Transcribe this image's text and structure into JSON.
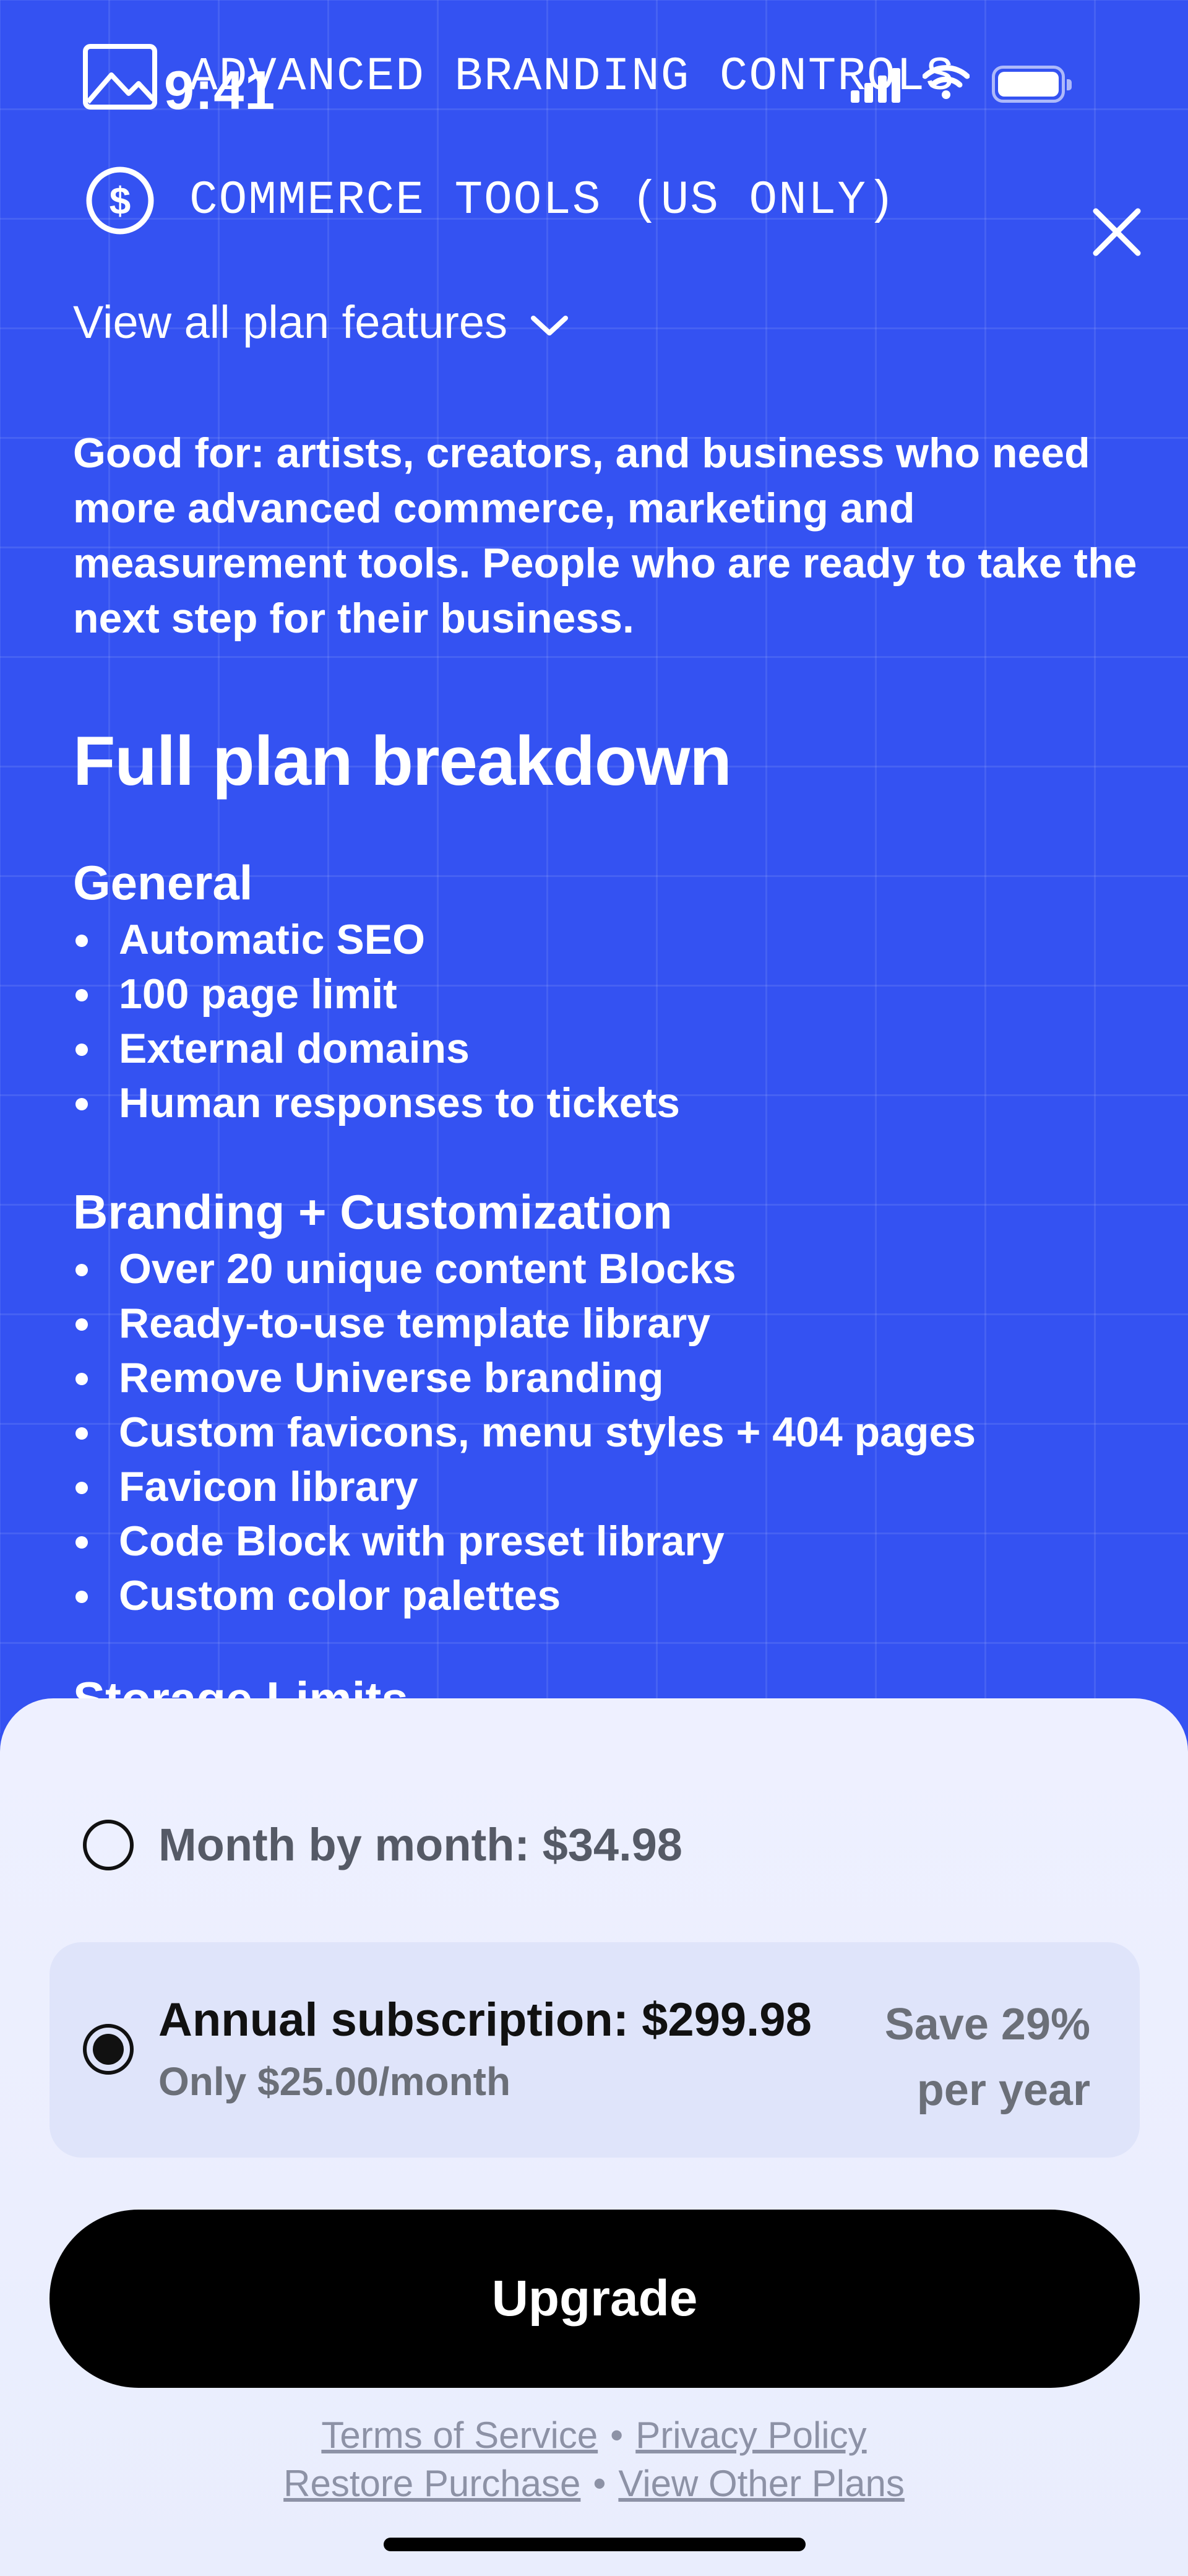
{
  "status_bar": {
    "time": "9:41"
  },
  "features": {
    "branding_label": "ADVANCED BRANDING CONTROLS",
    "commerce_label": "COMMERCE TOOLS (US ONLY)",
    "branding_icon": "image-icon",
    "commerce_icon": "dollar-circle-icon"
  },
  "view_all": {
    "label": "View all plan features",
    "icon": "chevron-down-icon"
  },
  "good_for": "Good for: artists, creators, and business who need more advanced commerce,  marketing and measurement tools. People who are ready to take the next step for their business.",
  "breakdown": {
    "title": "Full plan breakdown",
    "sections": [
      {
        "heading": "General",
        "items": [
          "Automatic SEO",
          "100 page limit",
          "External domains",
          "Human responses to tickets"
        ]
      },
      {
        "heading": "Branding + Customization",
        "items": [
          "Over 20 unique content Blocks",
          "Ready-to-use template library",
          "Remove Universe branding",
          "Custom favicons, menu styles + 404 pages",
          "Favicon library",
          "Code Block with preset library",
          "Custom color palettes"
        ]
      }
    ],
    "next_section_peek": "Storage Limits"
  },
  "plans": {
    "month": {
      "label": "Month by month: $34.98",
      "selected": false
    },
    "annual": {
      "label": "Annual subscription: $299.98",
      "sub": "Only $25.00/month",
      "save_line1": "Save 29%",
      "save_line2": "per year",
      "selected": true
    }
  },
  "upgrade_label": "Upgrade",
  "footer": {
    "terms": "Terms of Service",
    "privacy": "Privacy Policy",
    "restore": "Restore Purchase",
    "other_plans": "View Other Plans",
    "separator": "•"
  },
  "colors": {
    "background": "#3452F2",
    "sheet": "#EEF0FF",
    "button": "#000000"
  }
}
